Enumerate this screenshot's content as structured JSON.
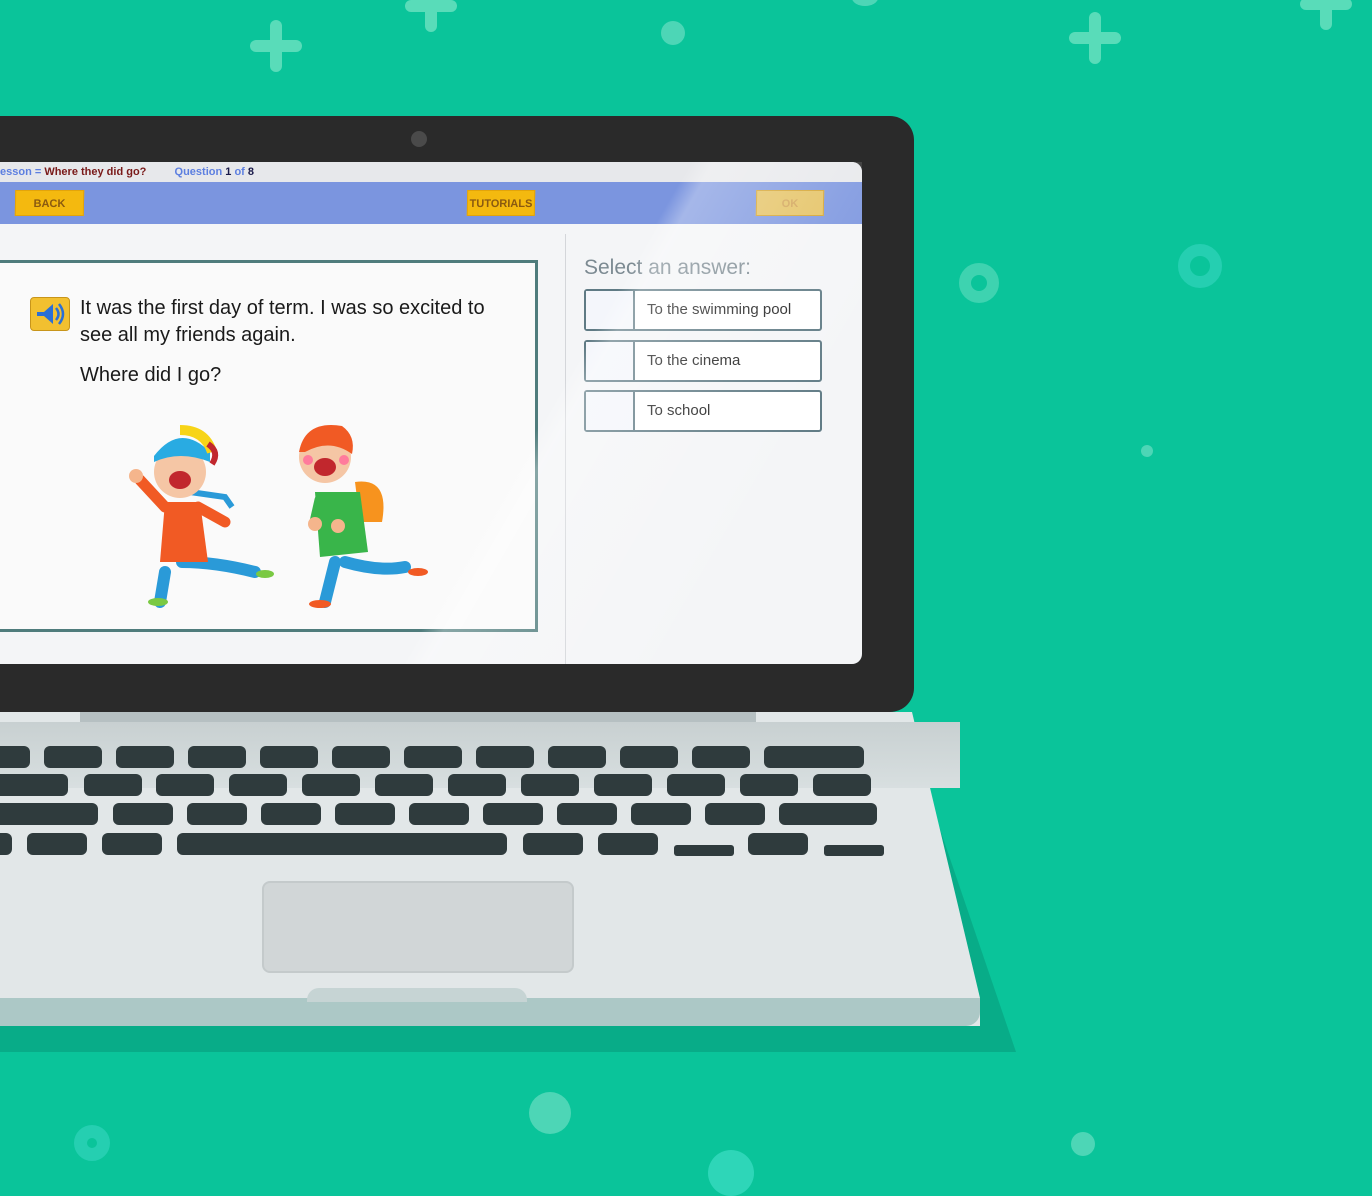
{
  "status_bar": {
    "lesson_prefix": "esson = ",
    "lesson_name": "Where they did go?",
    "question_label": "Question",
    "question_number": "1",
    "of_label": "of",
    "total": "8"
  },
  "toolbar": {
    "back_label": "BACK",
    "tutorials_label": "TUTORIALS",
    "ok_label": "OK"
  },
  "question": {
    "text": "It was the first day of term. I was so excited to see all my friends again.",
    "prompt": "Where did I go?",
    "audio_icon": "speaker-icon"
  },
  "answers": {
    "title": "Select an answer:",
    "options": [
      "To the swimming pool",
      "To the cinema",
      "To school"
    ]
  },
  "colors": {
    "background": "#0ac49a",
    "toolbar": "#7b95df",
    "button": "#f4b90f",
    "card_border": "#4f7c7c"
  }
}
